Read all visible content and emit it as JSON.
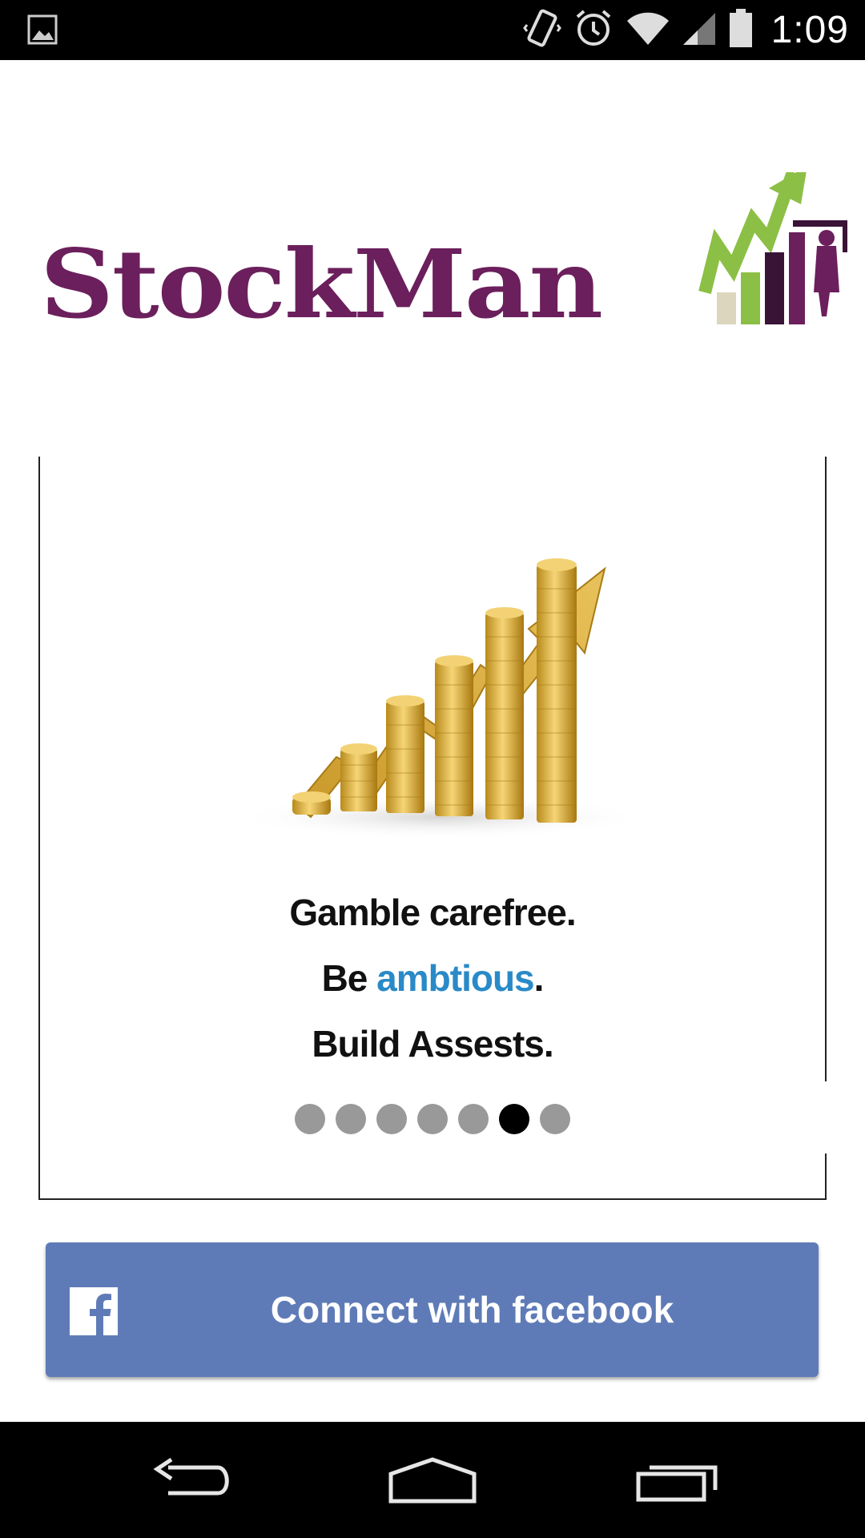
{
  "status_bar": {
    "time": "1:09",
    "icons": [
      "gallery-icon",
      "vibrate-icon",
      "alarm-icon",
      "wifi-icon",
      "signal-icon",
      "battery-icon"
    ]
  },
  "logo": {
    "text": "StockMan",
    "brand_color": "#6b1f5c"
  },
  "carousel": {
    "image": "coin-stacks-growth-icon",
    "tagline_line1": "Gamble carefree.",
    "tagline_line2_prefix": "Be ",
    "tagline_line2_accent": "ambtious",
    "tagline_line2_suffix": ".",
    "tagline_line3": "Build Assests.",
    "accent_color": "#2a8ac7",
    "page_count": 7,
    "active_page": 6
  },
  "facebook_button": {
    "label": "Connect with facebook",
    "icon": "facebook-icon",
    "color": "#5f7bb7"
  },
  "nav_bar": {
    "icons": [
      "back-icon",
      "home-icon",
      "recents-icon"
    ]
  }
}
